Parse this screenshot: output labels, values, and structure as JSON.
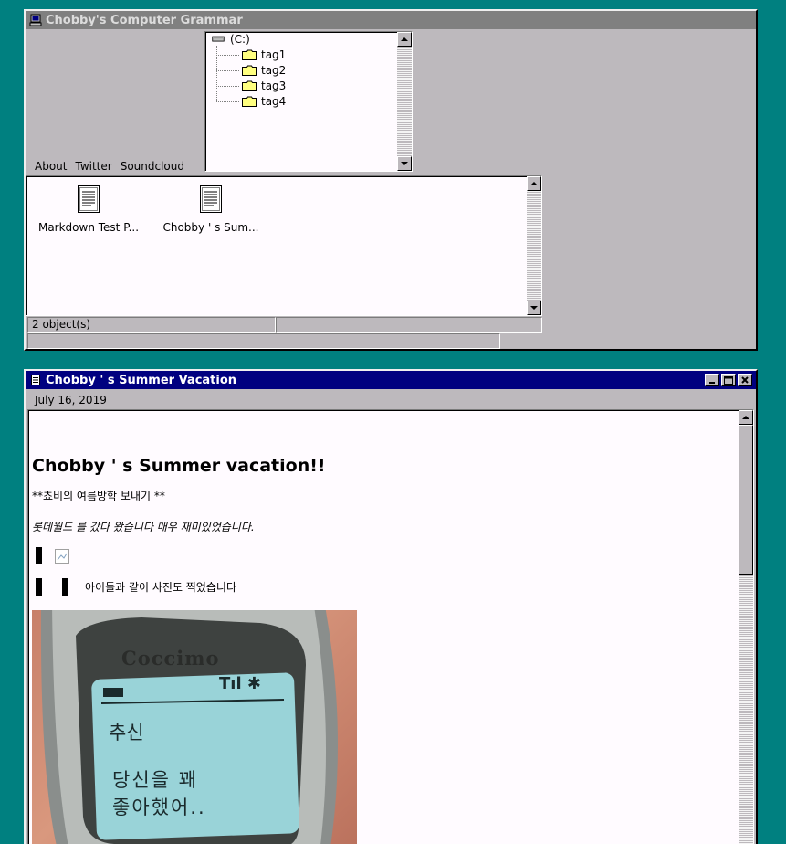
{
  "explorer": {
    "title": "Chobby's Computer Grammar",
    "tree": {
      "root": "(C:)",
      "children": [
        "tag1",
        "tag2",
        "tag3",
        "tag4"
      ]
    },
    "menu": [
      "About",
      "Twitter",
      "Soundcloud"
    ],
    "files": [
      {
        "label": "Markdown Test P...",
        "icon": "document-icon"
      },
      {
        "label": "Chobby ' s Sum...",
        "icon": "document-icon"
      }
    ],
    "status": "2 object(s)"
  },
  "post_window": {
    "title": "Chobby ' s Summer Vacation",
    "date": "July 16, 2019",
    "heading": "Chobby ' s Summer vacation!!",
    "line1": "**쵸비의 여름방학 보내기 **",
    "line2": "롯데월드 를 갔다 왔습니다 매우 재미있었습니다.",
    "line3": "아이들과 같이 사진도 찍었습니다",
    "phone": {
      "brand": "Coccimo",
      "screen_header": "추신",
      "screen_line1": "당신을 꽤",
      "screen_line2": "좋아했어.."
    }
  },
  "colors": {
    "desktop": "#008080",
    "window_face": "#bdb9bd",
    "active_title": "#000080",
    "inactive_title": "#808080"
  }
}
